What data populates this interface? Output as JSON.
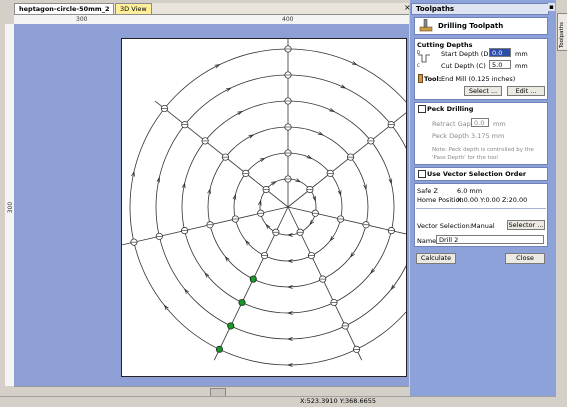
{
  "document": {
    "tab_name": "heptagon-circle-50mm_2",
    "view_tab": "3D View",
    "close_glyph": "×"
  },
  "rulers": {
    "top_labels": [
      "300",
      "400"
    ],
    "left_label": "300"
  },
  "status": {
    "coordinates": "X:523.3910 Y:368.6655"
  },
  "panel": {
    "title": "Toolpaths",
    "side_tab": "Toolpaths",
    "pin_glyph": "▪",
    "header": {
      "title": "Drilling Toolpath",
      "icon": "drill-icon"
    },
    "cutting_depths": {
      "title": "Cutting Depths",
      "start_label": "Start Depth (D)",
      "start_value": "0.0",
      "start_unit": "mm",
      "cut_label": "Cut Depth (C)",
      "cut_value": "5.0",
      "cut_unit": "mm",
      "tool_label": "Tool:",
      "tool_value": "End Mill (0.125 inches)",
      "select_btn": "Select ...",
      "edit_btn": "Edit ..."
    },
    "peck": {
      "title": "Peck Drilling",
      "retract_label": "Retract Gap",
      "retract_value": "0.0",
      "retract_unit": "mm",
      "peck_label": "Peck Depth",
      "peck_value": "3.175 mm",
      "note_line1": "Note: Peck depth is controlled by the",
      "note_line2": "'Pass Depth' for the tool"
    },
    "vector_order": {
      "label": "Use Vector Selection Order"
    },
    "settings": {
      "safe_label": "Safe Z",
      "safe_value": "6.0 mm",
      "home_label": "Home Position",
      "home_value": "X:0.00 Y:0.00 Z:20.00",
      "vector_sel_label": "Vector Selection:",
      "vector_sel_value": "Manual",
      "selector_btn": "Selector ...",
      "name_label": "Name:",
      "name_value": "Drill 2"
    },
    "calculate_btn": "Calculate",
    "close_btn": "Close"
  }
}
